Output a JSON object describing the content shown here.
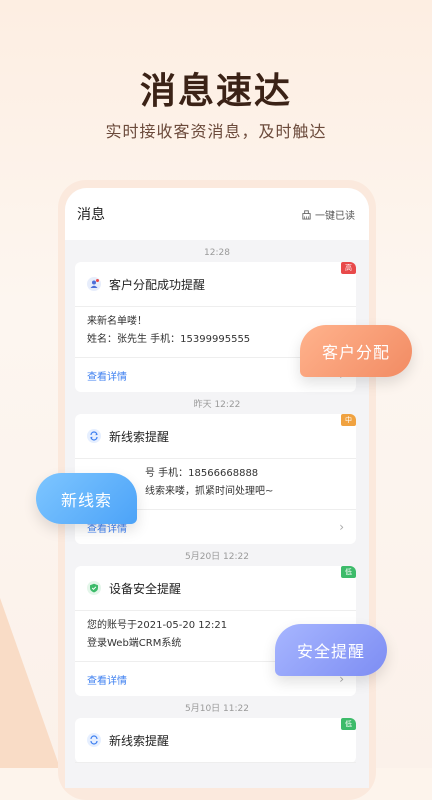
{
  "hero": {
    "title": "消息速达",
    "subtitle": "实时接收客资消息，及时触达"
  },
  "topbar": {
    "title": "消息",
    "read_all": "一键已读"
  },
  "messages": [
    {
      "time": "12:28",
      "title": "客户分配成功提醒",
      "badge": "高",
      "badge_color": "#e8494a",
      "icon": "user-icon",
      "lines": [
        "来新名单喽！",
        "姓名：张先生    手机：15399995555"
      ],
      "link": "查看详情"
    },
    {
      "time": "昨天 12:22",
      "title": "新线索提醒",
      "badge": "中",
      "badge_color": "#f0a240",
      "icon": "refresh-icon",
      "lines": [
        "号    手机：18566668888",
        "线索来喽，抓紧时间处理吧~"
      ],
      "link": "查看详情"
    },
    {
      "time": "5月20日 12:22",
      "title": "设备安全提醒",
      "badge": "低",
      "badge_color": "#3dbb6a",
      "icon": "shield-icon",
      "lines": [
        "您的账号于2021-05-20  12:21",
        "登录Web端CRM系统"
      ],
      "link": "查看详情"
    },
    {
      "time": "5月10日 11:22",
      "title": "新线索提醒",
      "badge": "低",
      "badge_color": "#3dbb6a",
      "icon": "refresh-icon"
    }
  ],
  "pills": {
    "assign": "客户分配",
    "lead": "新线索",
    "security": "安全提醒"
  }
}
